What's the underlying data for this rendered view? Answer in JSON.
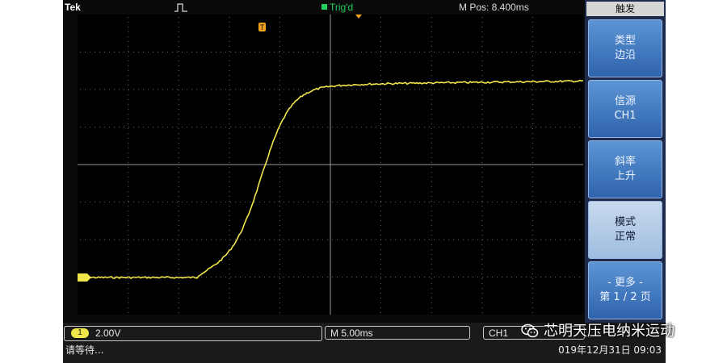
{
  "header": {
    "brand": "Tek",
    "trigger_status": "Trig'd",
    "position_readout": "M Pos: 8.400ms"
  },
  "side_menu": {
    "title": "触发",
    "buttons": [
      {
        "line1": "类型",
        "line2": "边沿"
      },
      {
        "line1": "信源",
        "line2": "CH1"
      },
      {
        "line1": "斜率",
        "line2": "上升"
      },
      {
        "line1": "模式",
        "line2": "正常"
      },
      {
        "line1": "- 更多 -",
        "line2": "第 1 / 2 页"
      }
    ]
  },
  "channel": {
    "badge": "1",
    "scale": "2.00V",
    "trace_color": "#f0e64a"
  },
  "timebase": {
    "label": "M 5.00ms"
  },
  "trigger_field": {
    "label": "CH1"
  },
  "status": {
    "message": "请等待..."
  },
  "datetime": "019年12月31日  09:03",
  "watermark": {
    "text": "芯明天压电纳米运动"
  },
  "colors": {
    "trace": "#f0e64a",
    "trigger": "#21d05e",
    "marker": "#f0a21e",
    "menu_active": "#c7d9ee",
    "menu_button": "#3f77c0"
  },
  "icons": {
    "header": "pulse-icon",
    "trigger_marker": "trigger-marker-icon",
    "trigger_position": "trigger-position-icon",
    "watermark": "wechat-icon"
  }
}
